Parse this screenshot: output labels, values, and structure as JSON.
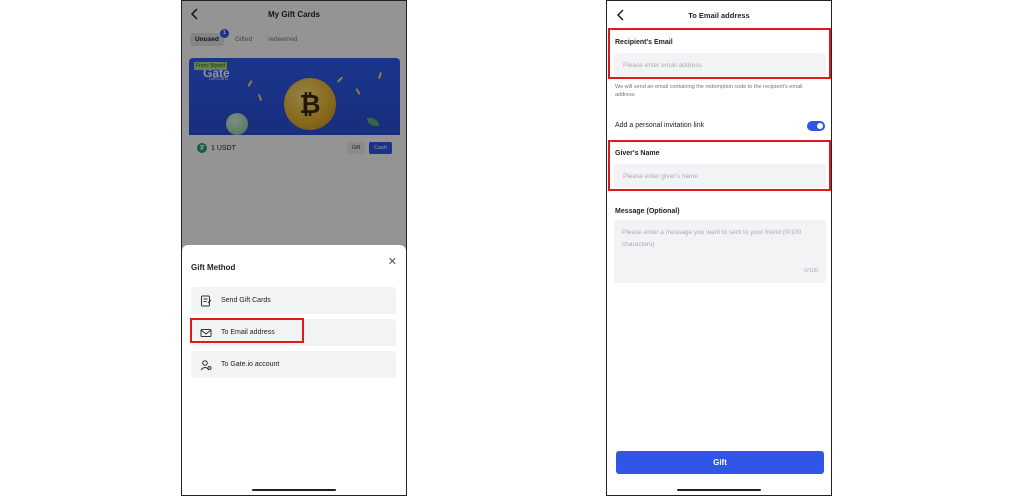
{
  "screen1": {
    "title": "My Gift Cards",
    "tabs": [
      {
        "label": "Unused",
        "badge": "1"
      },
      {
        "label": "Gifted"
      },
      {
        "label": "redeemed"
      }
    ],
    "card": {
      "from_tag": "From: Myself",
      "logo": "Gate",
      "logo_sub": "GiftCard",
      "amount": "1 USDT",
      "gift_label": "Gift",
      "cash_label": "Cash"
    },
    "sheet": {
      "title": "Gift Method",
      "options": [
        {
          "label": "Send Gift Cards",
          "icon": "gift-card-edit-icon"
        },
        {
          "label": "To Email address",
          "icon": "mail-icon"
        },
        {
          "label": "To Gate.io account",
          "icon": "user-account-icon"
        }
      ]
    }
  },
  "screen2": {
    "title": "To Email address",
    "recipient_label": "Recipient's Email",
    "recipient_placeholder": "Please enter email address",
    "help_text": "We will send an email containing the redemption code to the recipient's email address",
    "toggle_label": "Add a personal invitation link",
    "toggle_on": true,
    "giver_label": "Giver's Name",
    "giver_placeholder": "Please enter giver's name",
    "message_label": "Message (Optional)",
    "message_placeholder": "Please enter a message you want to sent to your friend (0/100 characters)",
    "counter": "0/100",
    "gift_button": "Gift"
  },
  "colors": {
    "accent": "#2f56e6",
    "highlight": "#e01a1a"
  }
}
